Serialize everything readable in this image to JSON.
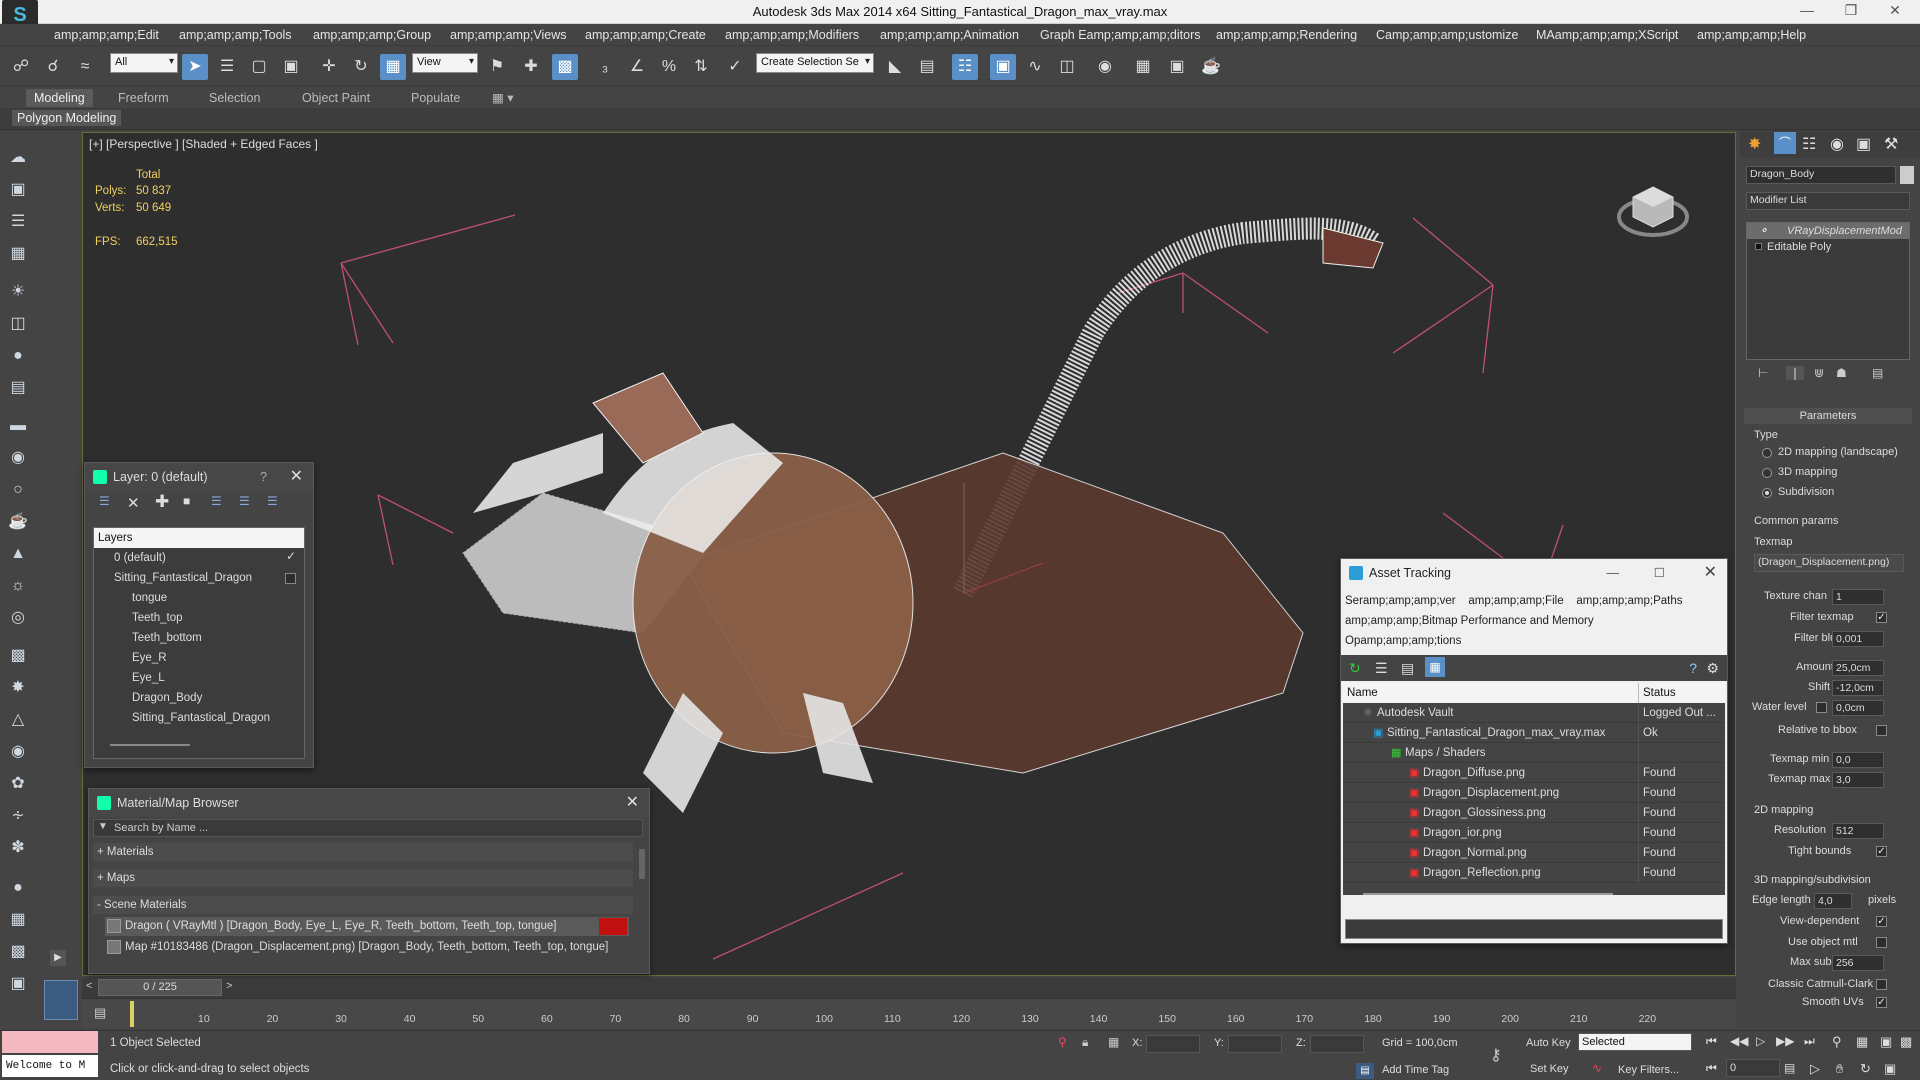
{
  "window": {
    "title": "Autodesk 3ds Max  2014 x64    Sitting_Fantastical_Dragon_max_vray.max"
  },
  "menu": [
    "amp;amp;amp;Edit",
    "amp;amp;amp;Tools",
    "amp;amp;amp;Group",
    "amp;amp;amp;Views",
    "amp;amp;amp;Create",
    "amp;amp;amp;Modifiers",
    "amp;amp;amp;Animation",
    "Graph Eamp;amp;amp;ditors",
    "amp;amp;amp;Rendering",
    "Camp;amp;amp;ustomize",
    "MAamp;amp;amp;XScript",
    "amp;amp;amp;Help"
  ],
  "toolbar": {
    "filter_value": "All",
    "refcoord_value": "View",
    "selection_set_value": "Create Selection Se"
  },
  "ribbon": {
    "tabs": [
      "Modeling",
      "Freeform",
      "Selection",
      "Object Paint",
      "Populate"
    ],
    "active": "Modeling",
    "sub_label": "Polygon Modeling"
  },
  "viewport": {
    "label": "[+] [Perspective ] [Shaded + Edged Faces ]",
    "stats": {
      "total_label": "Total",
      "polys_label": "Polys:",
      "polys": "50 837",
      "verts_label": "Verts:",
      "verts": "50 649",
      "fps_label": "FPS:",
      "fps": "662,515"
    }
  },
  "layer_panel": {
    "title": "Layer: 0 (default)",
    "help": "?",
    "column_header": "Layers",
    "rows": [
      "0 (default)",
      "Sitting_Fantastical_Dragon",
      "tongue",
      "Teeth_top",
      "Teeth_bottom",
      "Eye_R",
      "Eye_L",
      "Dragon_Body",
      "Sitting_Fantastical_Dragon"
    ]
  },
  "material_browser": {
    "title": "Material/Map Browser",
    "search_placeholder": "Search by Name ...",
    "groups": [
      "+ Materials",
      "+ Maps",
      "- Scene Materials"
    ],
    "items": [
      "Dragon  ( VRayMtl ) [Dragon_Body, Eye_L, Eye_R, Teeth_bottom, Teeth_top, tongue]",
      "Map #10183486 (Dragon_Displacement.png)  [Dragon_Body, Teeth_bottom, Teeth_top, tongue]"
    ]
  },
  "asset_tracking": {
    "title": "Asset Tracking",
    "menu_line1": [
      "Seramp;amp;amp;ver",
      "amp;amp;amp;File",
      "amp;amp;amp;Paths"
    ],
    "menu_line2": "amp;amp;amp;Bitmap Performance and Memory",
    "menu_line3": "Opamp;amp;amp;tions",
    "col_name": "Name",
    "col_status": "Status",
    "rows": [
      {
        "name": "Autodesk Vault",
        "status": "Logged Out ..."
      },
      {
        "name": "Sitting_Fantastical_Dragon_max_vray.max",
        "status": "Ok"
      },
      {
        "name": "Maps / Shaders",
        "status": ""
      },
      {
        "name": "Dragon_Diffuse.png",
        "status": "Found"
      },
      {
        "name": "Dragon_Displacement.png",
        "status": "Found"
      },
      {
        "name": "Dragon_Glossiness.png",
        "status": "Found"
      },
      {
        "name": "Dragon_ior.png",
        "status": "Found"
      },
      {
        "name": "Dragon_Normal.png",
        "status": "Found"
      },
      {
        "name": "Dragon_Reflection.png",
        "status": "Found"
      }
    ]
  },
  "command_panel": {
    "object_name": "Dragon_Body",
    "modifier_list": "Modifier List",
    "stack": [
      "VRayDisplacementMod",
      "Editable Poly"
    ],
    "rollout_title": "Parameters",
    "type_label": "Type",
    "type_options": [
      "2D mapping (landscape)",
      "3D mapping",
      "Subdivision"
    ],
    "common_label": "Common params",
    "texmap_label": "Texmap",
    "texmap_value": "(Dragon_Displacement.png)",
    "texture_chan_label": "Texture chan",
    "texture_chan": "1",
    "filter_texmap_label": "Filter texmap",
    "filter_blur_label": "Filter blur",
    "filter_blur": "0,001",
    "amount_label": "Amount",
    "amount": "25,0cm",
    "shift_label": "Shift",
    "shift": "-12,0cm",
    "water_label": "Water level",
    "water": "0,0cm",
    "relative_label": "Relative to bbox",
    "texmap_min_label": "Texmap min",
    "texmap_min": "0,0",
    "texmap_max_label": "Texmap max",
    "texmap_max": "3,0",
    "mapping2d_label": "2D mapping",
    "resolution_label": "Resolution",
    "resolution": "512",
    "tight_label": "Tight bounds",
    "mapping3d_label": "3D mapping/subdivision",
    "edge_label": "Edge length",
    "edge": "4,0",
    "pixels_label": "pixels",
    "view_dep_label": "View-dependent",
    "use_mtl_label": "Use object mtl",
    "max_subdivs_label": "Max subdivs",
    "max_subdivs": "256",
    "catmull_label": "Classic Catmull-Clark",
    "smooth_label": "Smooth UVs"
  },
  "timeline": {
    "frame_display": "0 / 225",
    "ticks": [
      "10",
      "20",
      "30",
      "40",
      "50",
      "60",
      "70",
      "80",
      "90",
      "100",
      "110",
      "120",
      "130",
      "140",
      "150",
      "160",
      "170",
      "180",
      "190",
      "200",
      "210",
      "220"
    ]
  },
  "status": {
    "objects_selected": "1 Object Selected",
    "prompt": "Click or click-and-drag to select objects",
    "welcome": "Welcome to M",
    "x_label": "X:",
    "y_label": "Y:",
    "z_label": "Z:",
    "grid": "Grid = 100,0cm",
    "add_time_tag": "Add Time Tag",
    "auto_key": "Auto Key",
    "set_key": "Set Key",
    "selected_value": "Selected",
    "key_filters": "Key Filters...",
    "frame": "0"
  },
  "colors": {
    "accent": "#5b8fc7",
    "grid_lines": "#c05070",
    "stat_text": "#f0d060"
  }
}
